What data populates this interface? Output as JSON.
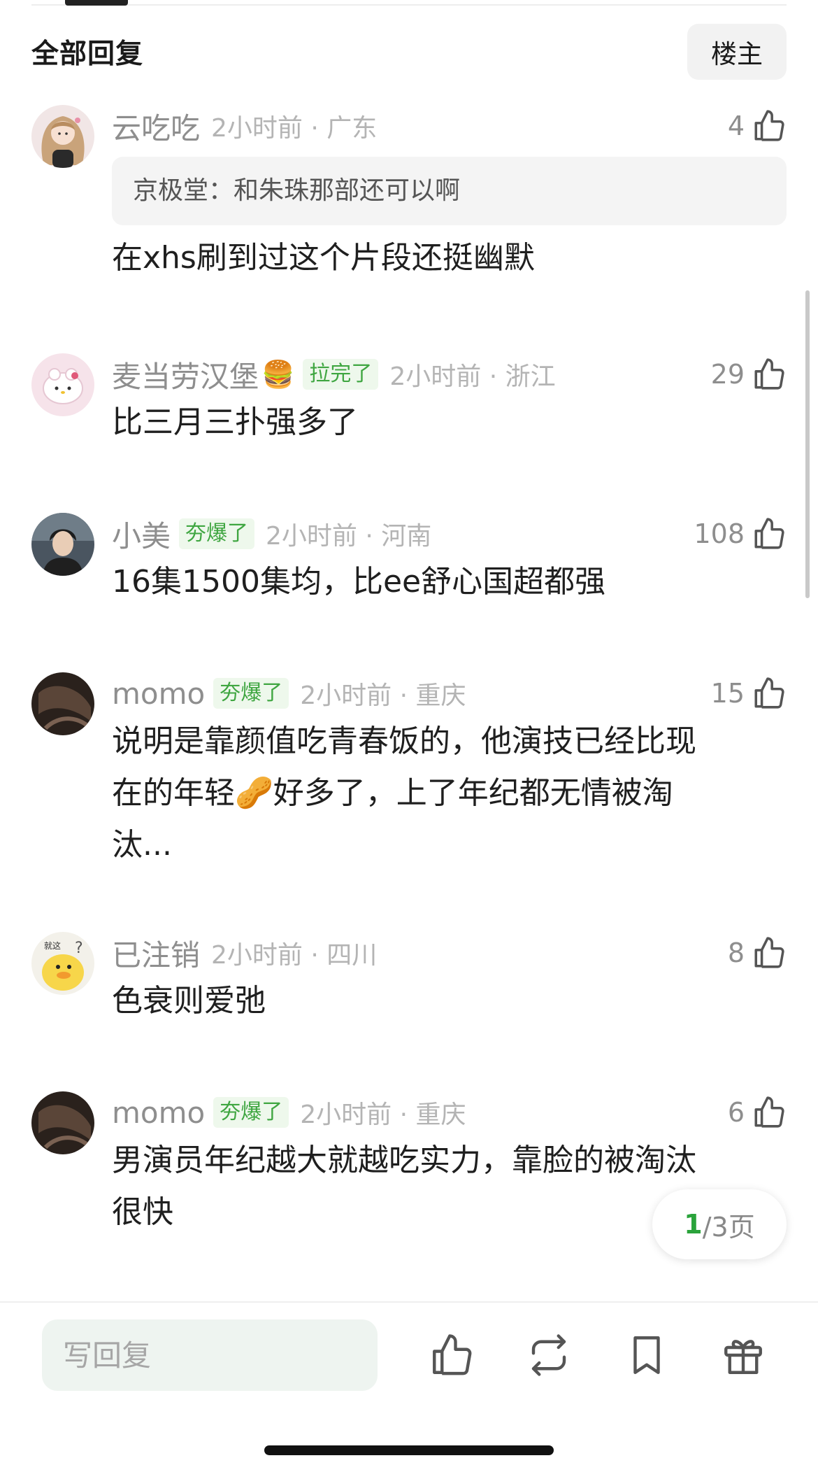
{
  "header": {
    "title": "全部回复",
    "op_button": "楼主"
  },
  "comments": [
    {
      "name": "云吃吃",
      "time_location": "2小时前 · 广东",
      "likes": "4",
      "quote": "京极堂：和朱珠那部还可以啊",
      "lines": [
        "在xhs刷到过这个片段还挺幽默"
      ],
      "avatar": "girl-avatar"
    },
    {
      "name": "麦当劳汉堡",
      "emoji": "🍔",
      "badge": "拉完了",
      "time_location": "2小时前 · 浙江",
      "likes": "29",
      "lines": [
        "比三月三扑强多了"
      ],
      "avatar": "hello-kitty-avatar"
    },
    {
      "name": "小美",
      "badge": "夯爆了",
      "time_location": "2小时前 · 河南",
      "likes": "108",
      "lines": [
        "16集1500集均，比ee舒心国超都强"
      ],
      "avatar": "man-avatar"
    },
    {
      "name": "momo",
      "badge": "夯爆了",
      "time_location": "2小时前 · 重庆",
      "likes": "15",
      "lines": [
        "说明是靠颜值吃青春饭的，他演技已经比现",
        "在的年轻🥜好多了，上了年纪都无情被淘",
        "汰..."
      ],
      "avatar": "dark-avatar"
    },
    {
      "name": "已注销",
      "time_location": "2小时前 · 四川",
      "likes": "8",
      "lines": [
        "色衰则爱弛"
      ],
      "avatar": "duck-avatar",
      "avatar_text": "就这"
    },
    {
      "name": "momo",
      "badge": "夯爆了",
      "time_location": "2小时前 · 重庆",
      "likes": "6",
      "lines": [
        "男演员年纪越大就越吃实力，靠脸的被淘汰",
        "很快"
      ],
      "avatar": "dark-avatar"
    }
  ],
  "pagination": {
    "current": "1",
    "total_suffix": "/3页"
  },
  "bottom_bar": {
    "reply_placeholder": "写回复",
    "icons": [
      "thumbs-up-icon",
      "repost-icon",
      "bookmark-icon",
      "gift-icon"
    ]
  },
  "colors": {
    "badge_green": "#3fa641",
    "badge_bg": "#eef8ec",
    "input_bg": "#eef4f0"
  }
}
